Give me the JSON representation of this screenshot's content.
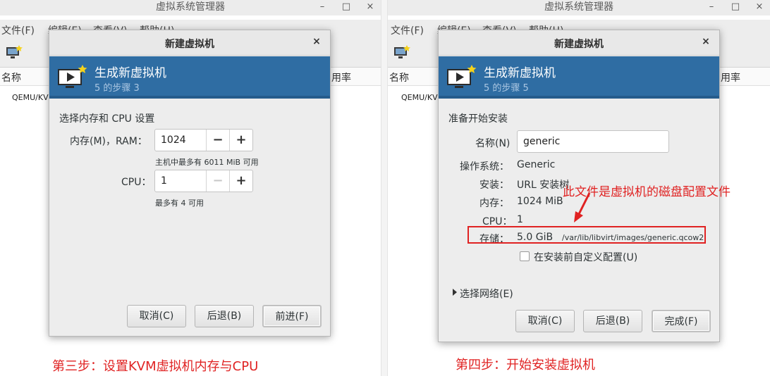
{
  "manager": {
    "title": "虚拟系统管理器",
    "menu": [
      "文件(F)",
      "编辑(E)",
      "查看(V)",
      "帮助(H)"
    ],
    "col_name": "名称",
    "col_usage": "用率",
    "connection": "QEMU/KVM",
    "controls": {
      "minimize": "–",
      "maximize": "□",
      "close": "×"
    }
  },
  "left_dialog": {
    "title": "新建虚拟机",
    "close": "×",
    "banner_title": "生成新虚拟机",
    "banner_step": "5 的步骤 3",
    "section": "选择内存和 CPU 设置",
    "memory_label": "内存(M)，RAM：",
    "memory_value": "1024",
    "memory_hint": "主机中最多有 6011 MiB 可用",
    "cpu_label": "CPU：",
    "cpu_value": "1",
    "cpu_hint": "最多有 4 可用",
    "minus": "−",
    "plus": "+",
    "cancel": "取消(C)",
    "back": "后退(B)",
    "forward": "前进(F)"
  },
  "right_dialog": {
    "title": "新建虚拟机",
    "close": "×",
    "banner_title": "生成新虚拟机",
    "banner_step": "5 的步骤 5",
    "section": "准备开始安装",
    "name_label": "名称(N)",
    "name_value": "generic",
    "os_label": "操作系统：",
    "os_value": "Generic",
    "install_label": "安装：",
    "install_value": "URL 安装树",
    "memory_label": "内存：",
    "memory_value": "1024 MiB",
    "cpu_label": "CPU：",
    "cpu_value": "1",
    "storage_label": "存储：",
    "storage_size": "5.0 GiB",
    "storage_path": "/var/lib/libvirt/images/generic.qcow2",
    "customize": "在安装前自定义配置(U)",
    "network": "选择网络(E)",
    "cancel": "取消(C)",
    "back": "后退(B)",
    "finish": "完成(F)"
  },
  "annotations": {
    "disk_note": "此文件是虚拟机的磁盘配置文件",
    "left_caption": "第三步：设置KVM虚拟机内存与CPU",
    "right_caption": "第四步：开始安装虚拟机"
  },
  "colors": {
    "banner": "#2f6da3",
    "annotation": "#e02222"
  }
}
